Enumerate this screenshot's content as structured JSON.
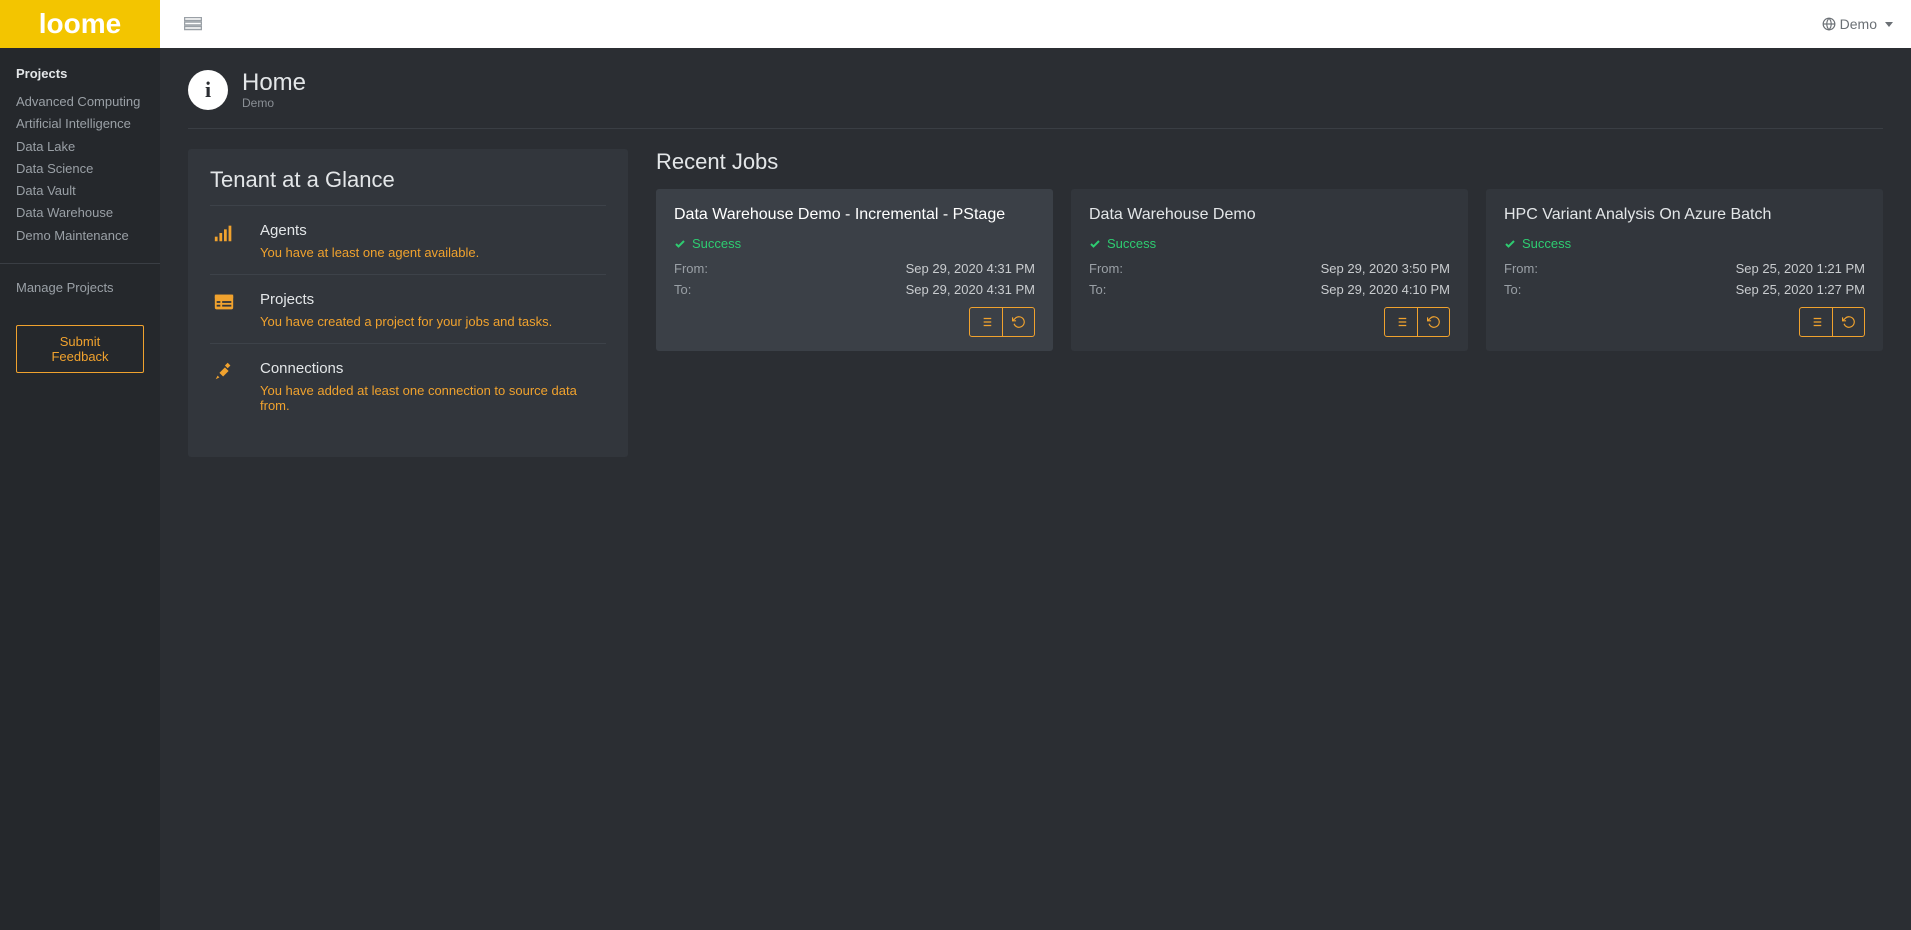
{
  "brand": "loome",
  "header": {
    "tenant_label": "Demo"
  },
  "sidebar": {
    "projects_heading": "Projects",
    "projects": [
      "Advanced Computing",
      "Artificial Intelligence",
      "Data Lake",
      "Data Science",
      "Data Vault",
      "Data Warehouse",
      "Demo Maintenance"
    ],
    "manage_label": "Manage Projects",
    "feedback_label": "Submit Feedback"
  },
  "page": {
    "title": "Home",
    "subtitle": "Demo"
  },
  "glance": {
    "heading": "Tenant at a Glance",
    "items": [
      {
        "icon": "signal",
        "title": "Agents",
        "desc": "You have at least one agent available."
      },
      {
        "icon": "list",
        "title": "Projects",
        "desc": "You have created a project for your jobs and tasks."
      },
      {
        "icon": "plug",
        "title": "Connections",
        "desc": "You have added at least one connection to source data from."
      }
    ]
  },
  "recent": {
    "heading": "Recent Jobs",
    "from_label": "From:",
    "to_label": "To:",
    "jobs": [
      {
        "title": "Data Warehouse Demo - Incremental - PStage",
        "status": "Success",
        "from": "Sep 29, 2020 4:31 PM",
        "to": "Sep 29, 2020 4:31 PM",
        "selected": true
      },
      {
        "title": "Data Warehouse Demo",
        "status": "Success",
        "from": "Sep 29, 2020 3:50 PM",
        "to": "Sep 29, 2020 4:10 PM",
        "selected": false
      },
      {
        "title": "HPC Variant Analysis On Azure Batch",
        "status": "Success",
        "from": "Sep 25, 2020 1:21 PM",
        "to": "Sep 25, 2020 1:27 PM",
        "selected": false
      }
    ]
  }
}
